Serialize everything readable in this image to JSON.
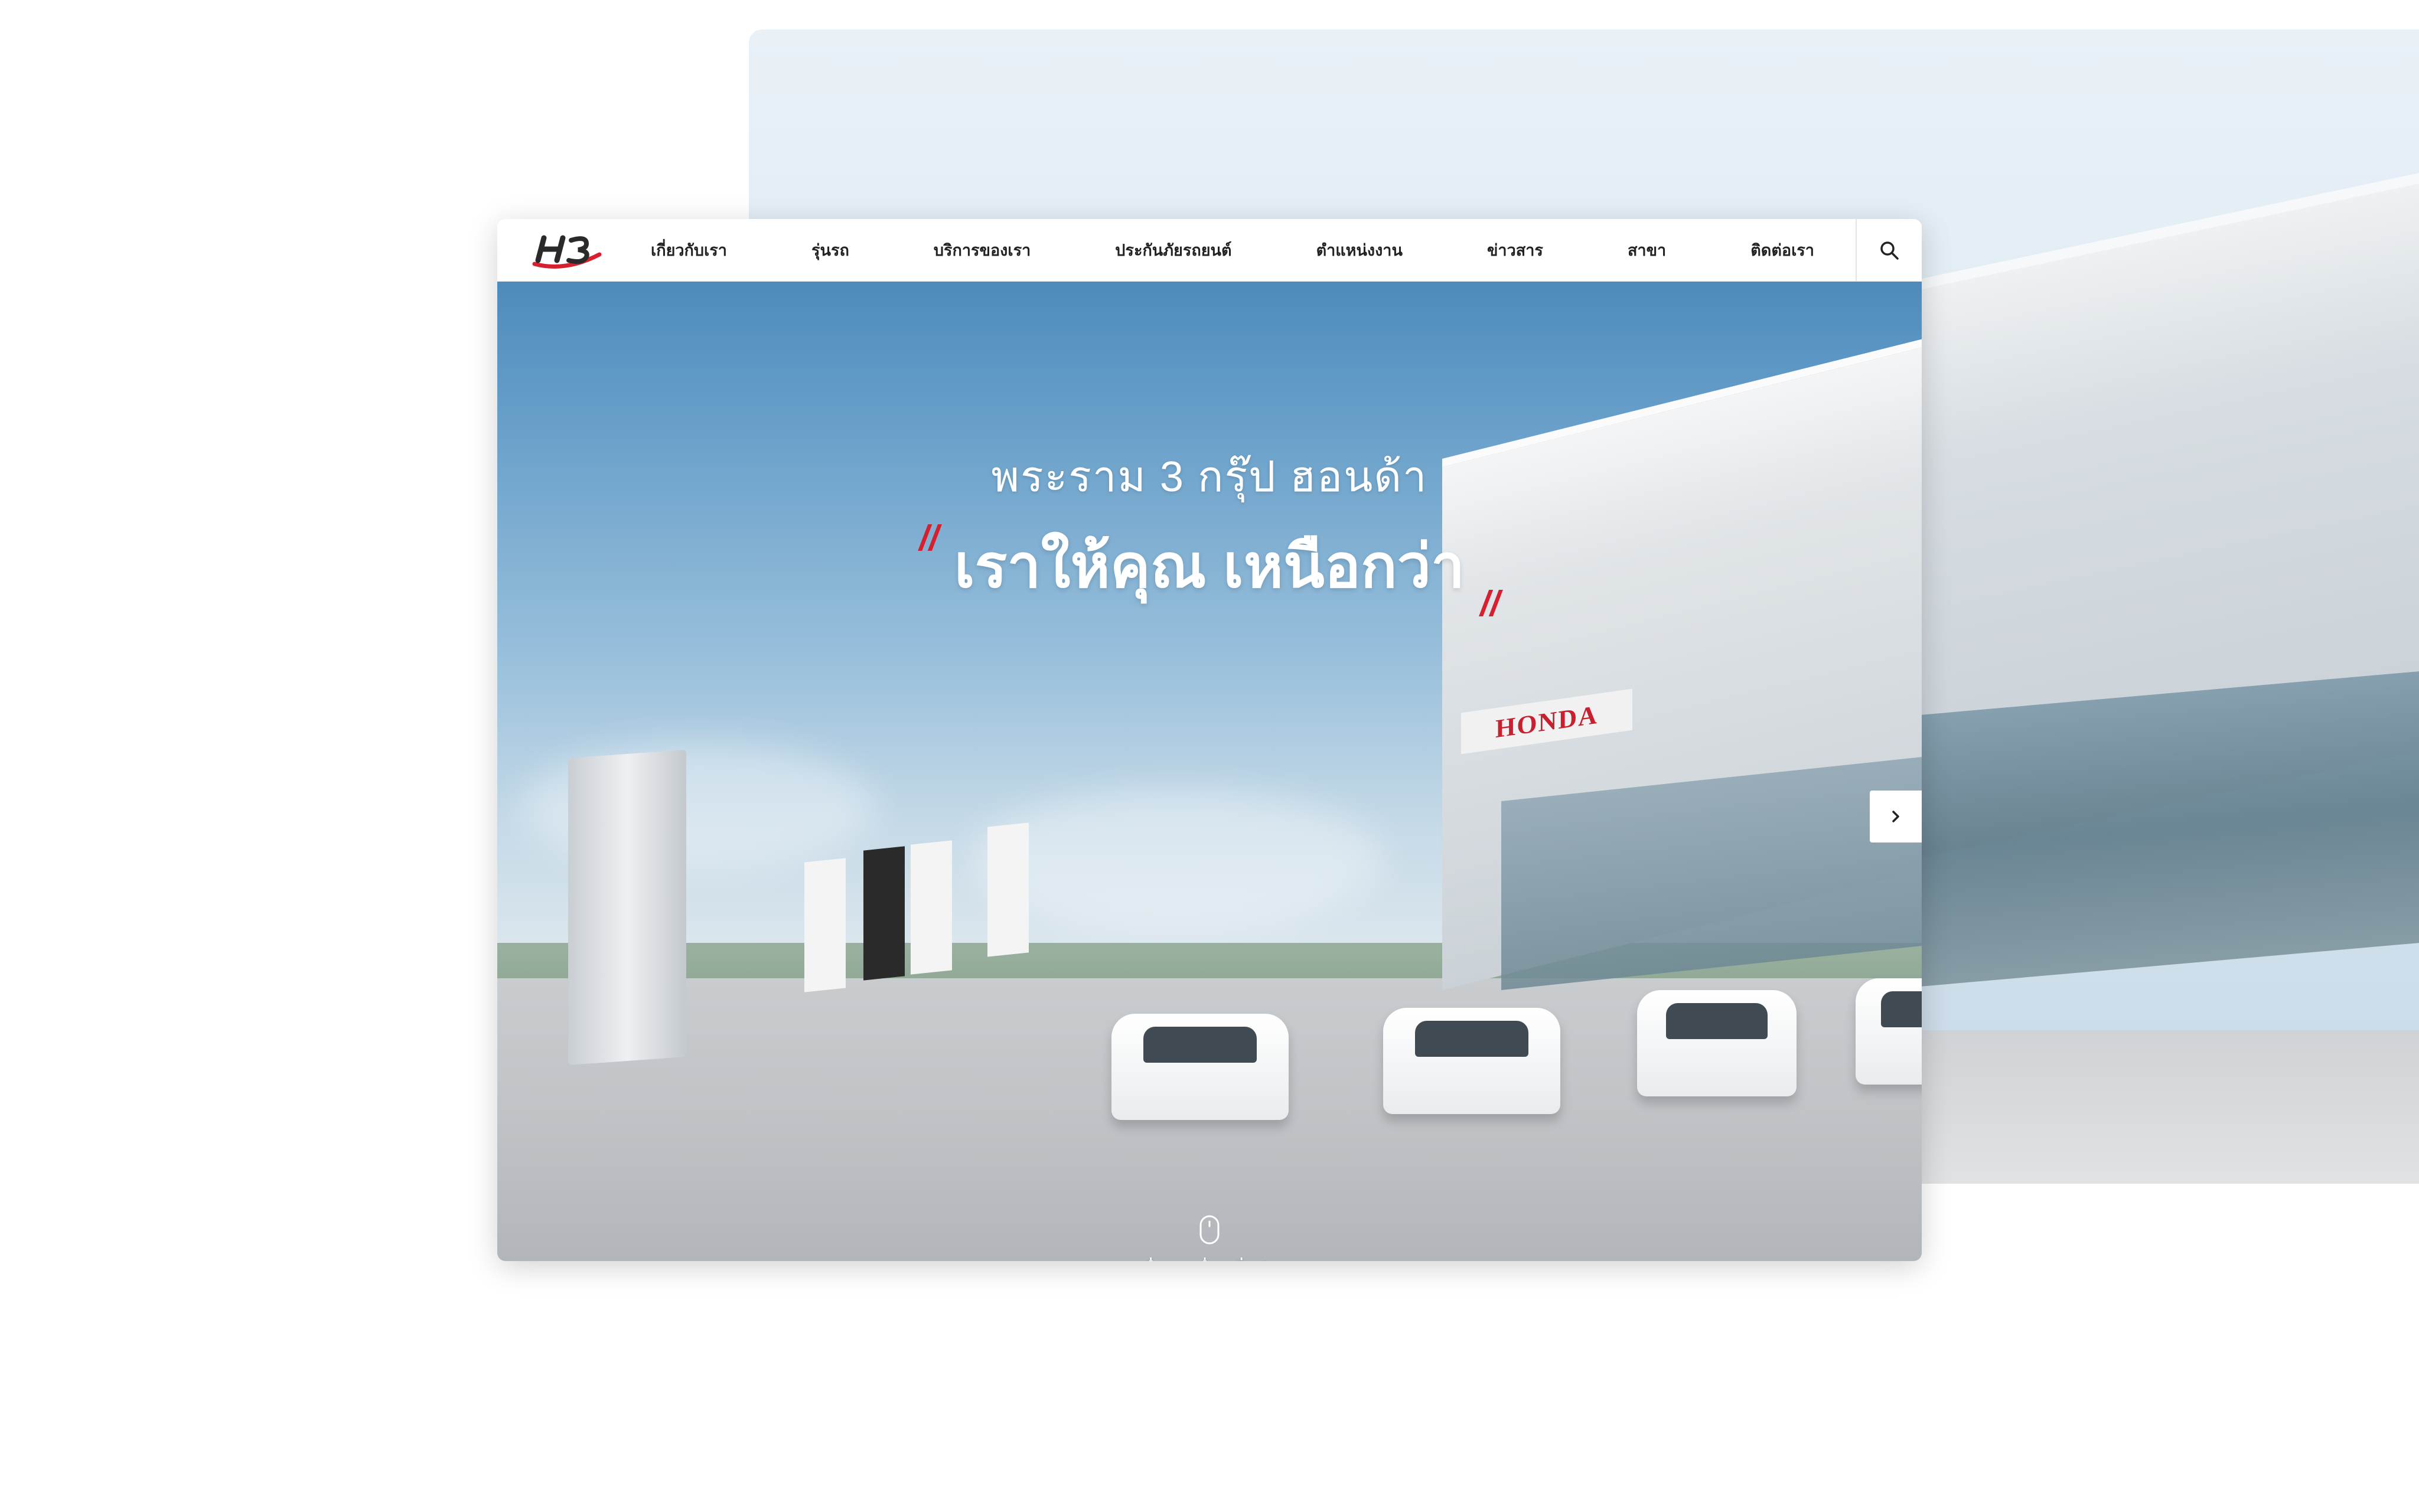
{
  "brand": {
    "logo_text": "H3",
    "accent_color": "#d6202f"
  },
  "nav": {
    "items": [
      {
        "label": "เกี่ยวกับเรา"
      },
      {
        "label": "รุ่นรถ"
      },
      {
        "label": "บริการของเรา"
      },
      {
        "label": "ประกันภัยรถยนต์"
      },
      {
        "label": "ตำแหน่งงาน"
      },
      {
        "label": "ข่าวสาร"
      },
      {
        "label": "สาขา"
      },
      {
        "label": "ติดต่อเรา"
      }
    ],
    "search_icon": "search-icon"
  },
  "hero": {
    "subtitle": "พระราม 3 กรุ๊ป ฮอนด้า",
    "title": "เราให้คุณ เหนือกว่า",
    "quote_open": "//",
    "quote_close": "//",
    "showroom_sign": "HONDA",
    "next_icon": "chevron-right-icon",
    "scroll_text": "เลื่อนลงเพื่อดูเพิ่มเติม",
    "scroll_icon": "mouse-icon"
  }
}
